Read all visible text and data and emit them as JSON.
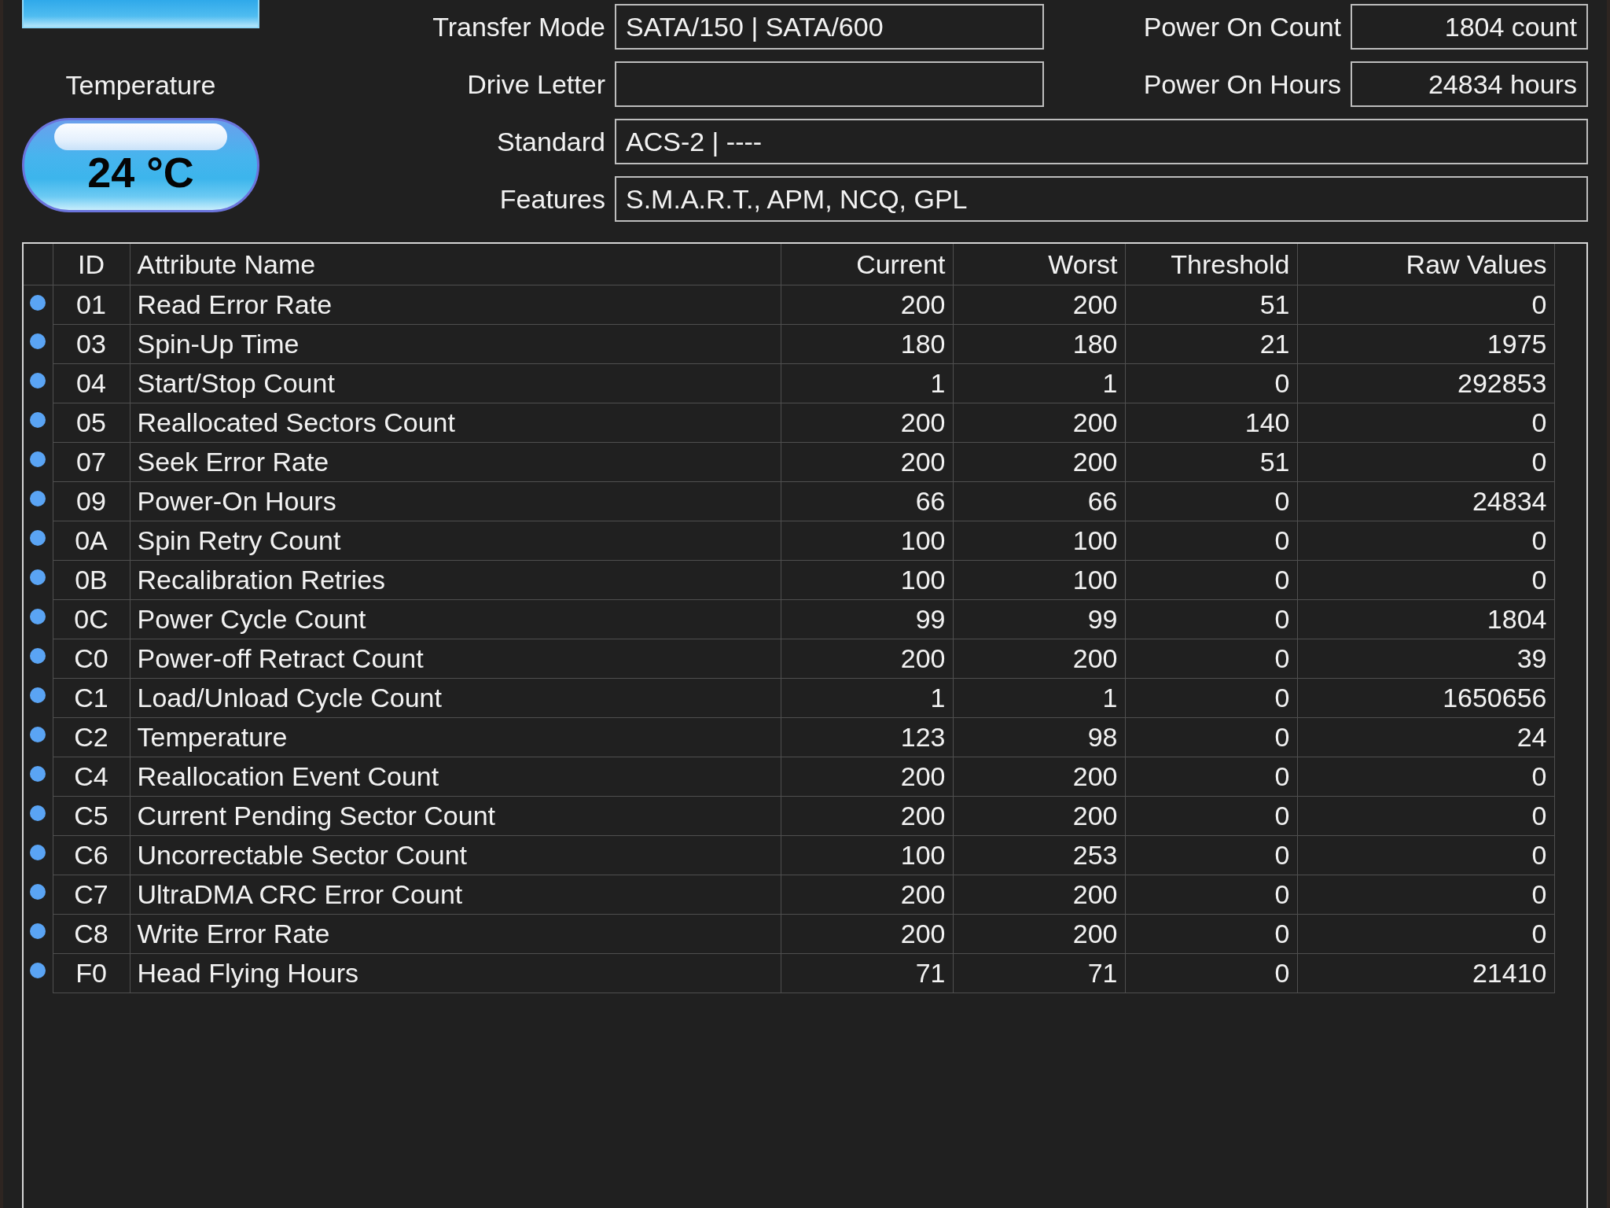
{
  "temperature": {
    "label": "Temperature",
    "value": "24 °C"
  },
  "info_rows": [
    {
      "fields": [
        {
          "label": "Transfer Mode",
          "value": "SATA/150 | SATA/600"
        },
        {
          "label": "Power On Count",
          "value": "1804 count"
        }
      ]
    },
    {
      "fields": [
        {
          "label": "Drive Letter"
        },
        {
          "label": "Power On Hours",
          "value": "24834 hours"
        }
      ]
    },
    {
      "fields": [
        {
          "label": "Standard",
          "value": "ACS-2 | ----"
        }
      ]
    },
    {
      "fields": [
        {
          "label": "Features",
          "value": "S.M.A.R.T., APM, NCQ, GPL"
        }
      ]
    }
  ],
  "table": {
    "columns": [
      "ID",
      "Attribute Name",
      "Current",
      "Worst",
      "Threshold",
      "Raw Values"
    ],
    "rows": [
      {
        "color": "#5aa4f4",
        "cells": [
          "01",
          "Read Error Rate",
          "200",
          "200",
          "51",
          "0"
        ]
      },
      {
        "color": "#5aa4f4",
        "cells": [
          "03",
          "Spin-Up Time",
          "180",
          "180",
          "21",
          "1975"
        ]
      },
      {
        "color": "#5aa4f4",
        "cells": [
          "04",
          "Start/Stop Count",
          "1",
          "1",
          "0",
          "292853"
        ]
      },
      {
        "color": "#5aa4f4",
        "cells": [
          "05",
          "Reallocated Sectors Count",
          "200",
          "200",
          "140",
          "0"
        ]
      },
      {
        "color": "#5aa4f4",
        "cells": [
          "07",
          "Seek Error Rate",
          "200",
          "200",
          "51",
          "0"
        ]
      },
      {
        "color": "#5aa4f4",
        "cells": [
          "09",
          "Power-On Hours",
          "66",
          "66",
          "0",
          "24834"
        ]
      },
      {
        "color": "#5aa4f4",
        "cells": [
          "0A",
          "Spin Retry Count",
          "100",
          "100",
          "0",
          "0"
        ]
      },
      {
        "color": "#5aa4f4",
        "cells": [
          "0B",
          "Recalibration Retries",
          "100",
          "100",
          "0",
          "0"
        ]
      },
      {
        "color": "#5aa4f4",
        "cells": [
          "0C",
          "Power Cycle Count",
          "99",
          "99",
          "0",
          "1804"
        ]
      },
      {
        "color": "#5aa4f4",
        "cells": [
          "C0",
          "Power-off Retract Count",
          "200",
          "200",
          "0",
          "39"
        ]
      },
      {
        "color": "#5aa4f4",
        "cells": [
          "C1",
          "Load/Unload Cycle Count",
          "1",
          "1",
          "0",
          "1650656"
        ]
      },
      {
        "color": "#5aa4f4",
        "cells": [
          "C2",
          "Temperature",
          "123",
          "98",
          "0",
          "24"
        ]
      },
      {
        "color": "#5aa4f4",
        "cells": [
          "C4",
          "Reallocation Event Count",
          "200",
          "200",
          "0",
          "0"
        ]
      },
      {
        "color": "#5aa4f4",
        "cells": [
          "C5",
          "Current Pending Sector Count",
          "200",
          "200",
          "0",
          "0"
        ]
      },
      {
        "color": "#5aa4f4",
        "cells": [
          "C6",
          "Uncorrectable Sector Count",
          "100",
          "253",
          "0",
          "0"
        ]
      },
      {
        "color": "#5aa4f4",
        "cells": [
          "C7",
          "UltraDMA CRC Error Count",
          "200",
          "200",
          "0",
          "0"
        ]
      },
      {
        "color": "#5aa4f4",
        "cells": [
          "C8",
          "Write Error Rate",
          "200",
          "200",
          "0",
          "0"
        ]
      },
      {
        "color": "#5aa4f4",
        "cells": [
          "F0",
          "Head Flying Hours",
          "71",
          "71",
          "0",
          "21410"
        ]
      }
    ]
  }
}
